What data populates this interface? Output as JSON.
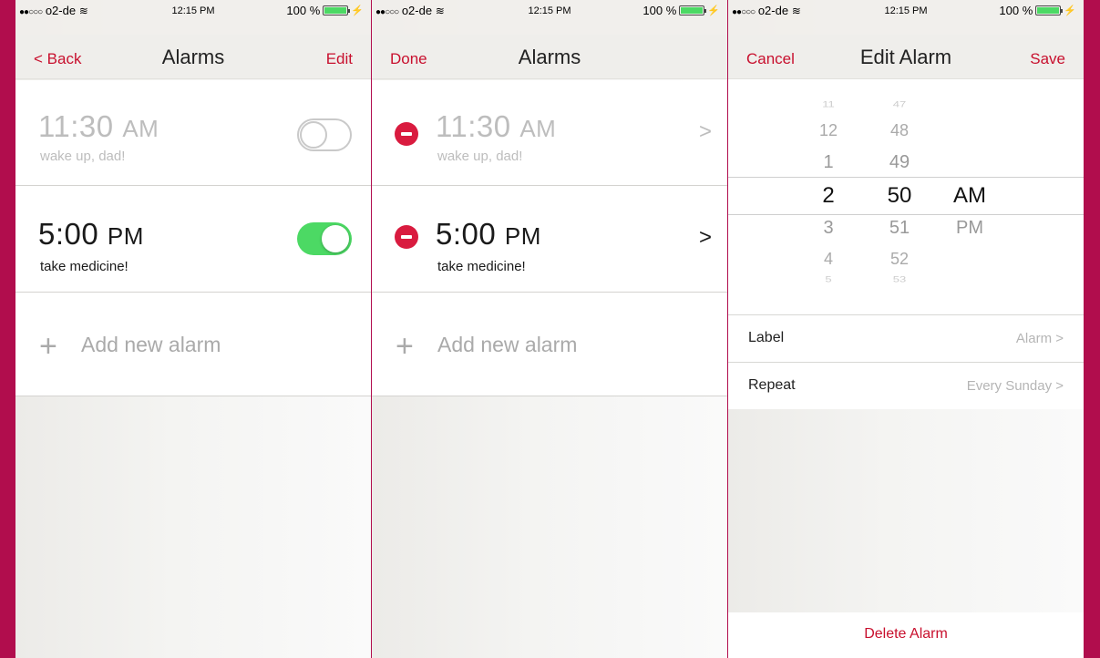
{
  "status": {
    "carrier": "o2-de",
    "time": "12:15 PM",
    "battery": "100 %"
  },
  "screen1": {
    "nav": {
      "left": "< Back",
      "title": "Alarms",
      "right": "Edit"
    },
    "alarms": [
      {
        "time": "11:30",
        "ampm": "AM",
        "label": "wake up, dad!",
        "enabled": false
      },
      {
        "time": "5:00",
        "ampm": "PM",
        "label": "take medicine!",
        "enabled": true
      }
    ],
    "add_label": "Add new alarm"
  },
  "screen2": {
    "nav": {
      "left": "Done",
      "title": "Alarms"
    },
    "alarms": [
      {
        "time": "11:30",
        "ampm": "AM",
        "label": "wake up, dad!"
      },
      {
        "time": "5:00",
        "ampm": "PM",
        "label": "take medicine!"
      }
    ],
    "chevron": ">",
    "add_label": "Add new alarm"
  },
  "screen3": {
    "nav": {
      "left": "Cancel",
      "title": "Edit Alarm",
      "right": "Save"
    },
    "picker": {
      "hours": [
        "11",
        "12",
        "1",
        "2",
        "3",
        "4",
        "5"
      ],
      "minutes": [
        "47",
        "48",
        "49",
        "50",
        "51",
        "52",
        "53"
      ],
      "period": [
        "AM",
        "PM"
      ],
      "selected": {
        "hour": "2",
        "minute": "50",
        "period": "AM"
      }
    },
    "label_row": {
      "label": "Label",
      "value": "Alarm >"
    },
    "repeat_row": {
      "label": "Repeat",
      "value": "Every Sunday >"
    },
    "delete_label": "Delete Alarm"
  },
  "colors": {
    "accent": "#c8102e",
    "frame": "#b10d4d",
    "toggle_on": "#4cd964",
    "delete_minus": "#d91b3f"
  },
  "icons": [
    "signal-dots-icon",
    "wifi-icon",
    "battery-icon",
    "charging-bolt-icon",
    "plus-icon",
    "minus-circle-icon",
    "chevron-right-icon"
  ]
}
